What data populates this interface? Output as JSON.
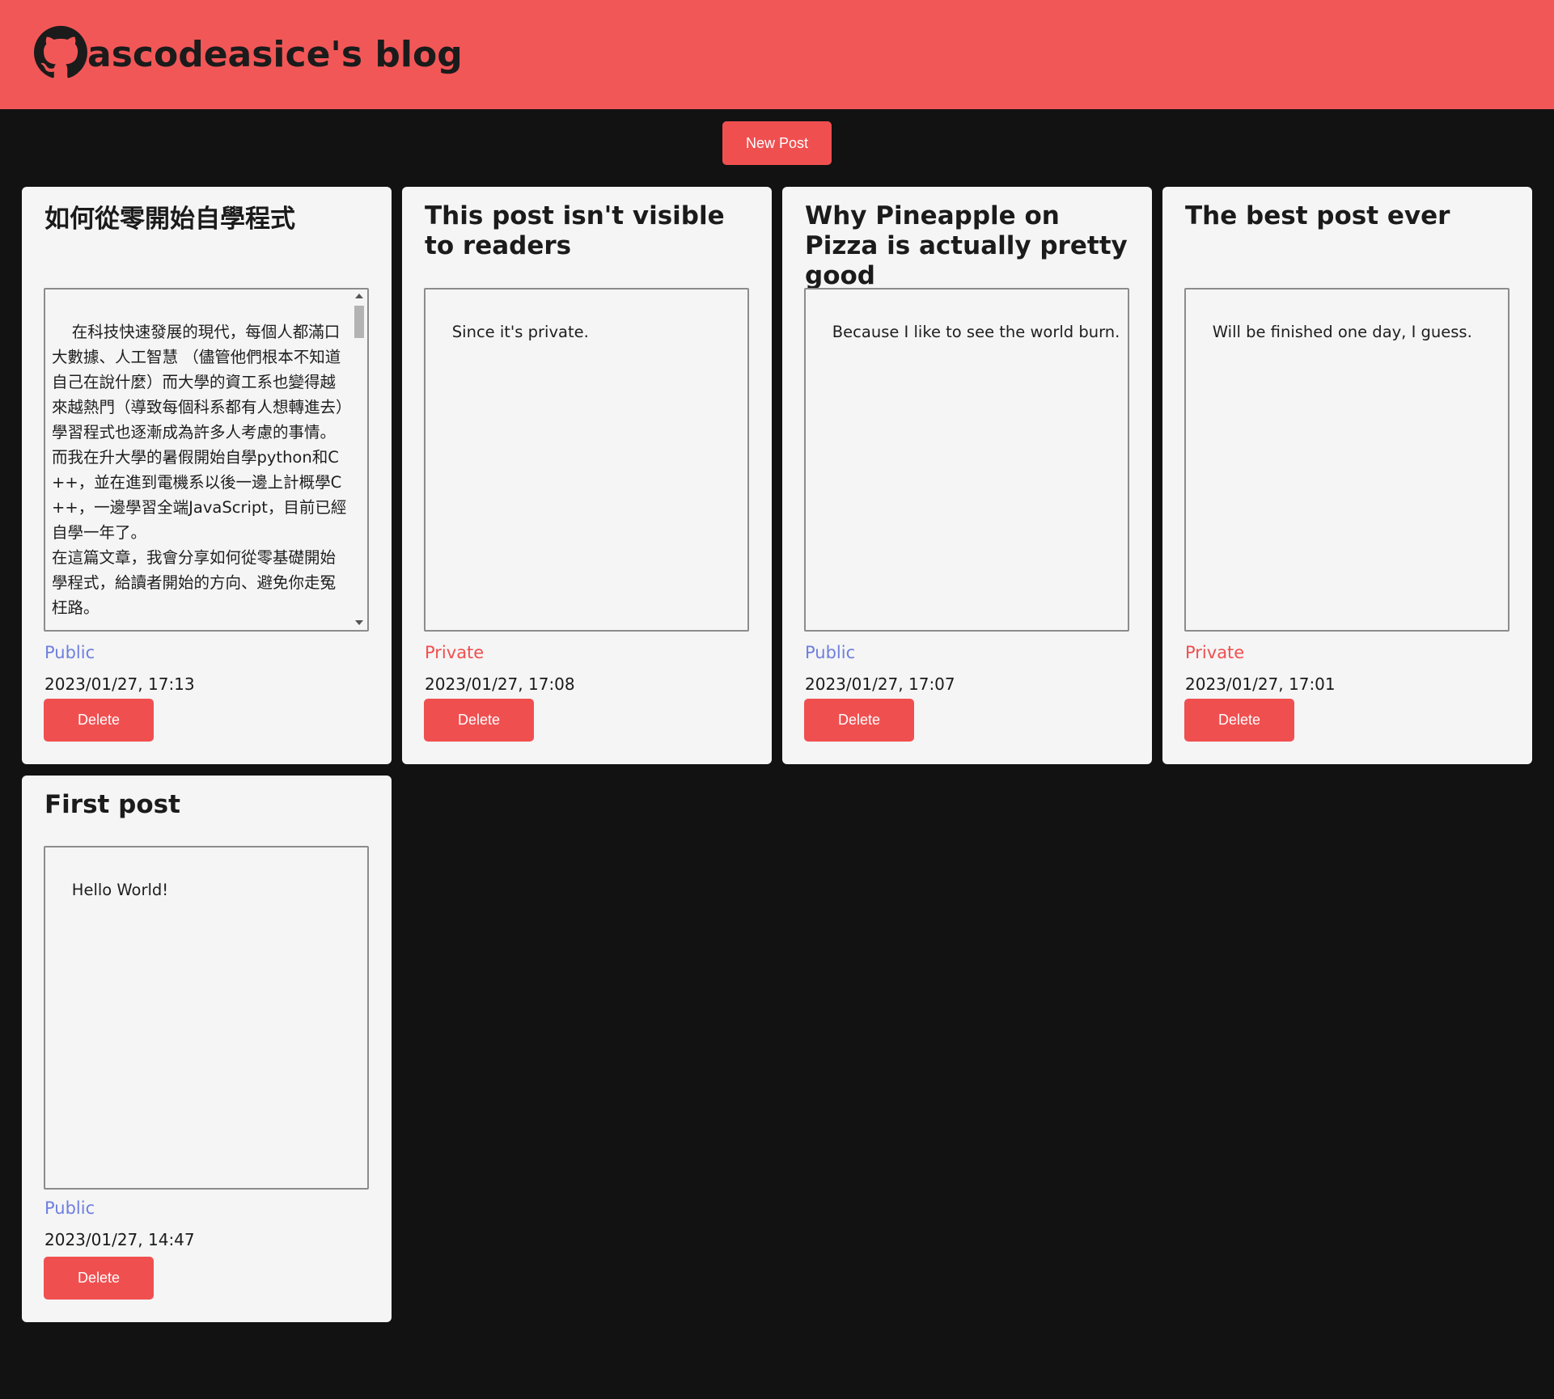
{
  "header": {
    "title": "ascodeasice's blog",
    "logo_icon": "github-icon"
  },
  "toolbar": {
    "new_post_label": "New Post"
  },
  "colors": {
    "header_bg": "#f25757",
    "page_bg": "#121212",
    "card_bg": "#f5f5f5",
    "button_bg": "#f04f50",
    "public": "#6e7fe0",
    "private": "#f04f50"
  },
  "posts": [
    {
      "title": "如何從零開始自學程式",
      "body": "在科技快速發展的現代，每個人都滿口大數據、人工智慧 （儘管他們根本不知道自己在說什麼）而大學的資工系也變得越來越熱門（導致每個科系都有人想轉進去）學習程式也逐漸成為許多人考慮的事情。\n而我在升大學的暑假開始自學python和C++，並在進到電機系以後一邊上計概學C++，一邊學習全端JavaScript，目前已經自學一年了。\n在這篇文章，我會分享如何從零基礎開始學程式，給讀者開始的方向、避免你走冤枉路。",
      "visibility": "Public",
      "timestamp": "2023/01/27, 17:13",
      "delete_label": "Delete"
    },
    {
      "title": "This post isn't visible to readers",
      "body": "Since it's private.",
      "visibility": "Private",
      "timestamp": "2023/01/27, 17:08",
      "delete_label": "Delete"
    },
    {
      "title": "Why Pineapple on Pizza is actually pretty good",
      "body": "Because I like to see the world burn.",
      "visibility": "Public",
      "timestamp": "2023/01/27, 17:07",
      "delete_label": "Delete"
    },
    {
      "title": "The best post ever",
      "body": "Will be finished one day, I guess.",
      "visibility": "Private",
      "timestamp": "2023/01/27, 17:01",
      "delete_label": "Delete"
    },
    {
      "title": "First post",
      "body": "Hello World!",
      "visibility": "Public",
      "timestamp": "2023/01/27, 14:47",
      "delete_label": "Delete"
    }
  ]
}
